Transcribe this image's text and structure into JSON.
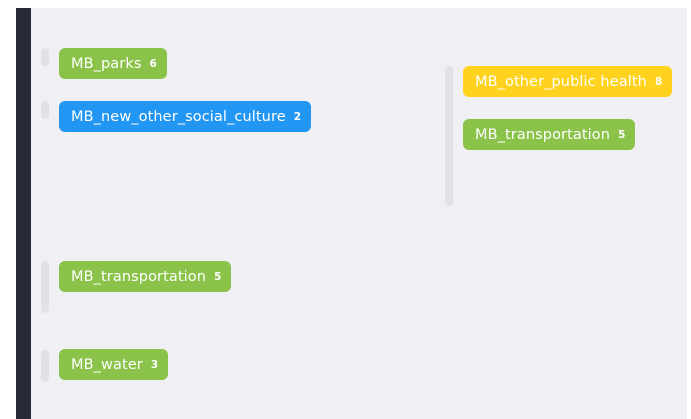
{
  "colors": {
    "sidebar": "#262b37",
    "canvas": "#f0f0f4",
    "handle": "#e1e1e6",
    "green": "#8bc34a",
    "blue": "#2196f3",
    "yellow": "#ffd21e"
  },
  "tags": [
    {
      "label": "MB_parks",
      "count": "6",
      "color": "#8bc34a"
    },
    {
      "label": "MB_new_other_social_culture",
      "count": "2",
      "color": "#2196f3"
    },
    {
      "label": "MB_transportation",
      "count": "5",
      "color": "#8bc34a"
    },
    {
      "label": "MB_water",
      "count": "3",
      "color": "#8bc34a"
    },
    {
      "label": "MB_other_public health",
      "count": "8",
      "color": "#ffd21e"
    },
    {
      "label": "MB_transportation",
      "count": "5",
      "color": "#8bc34a"
    }
  ]
}
